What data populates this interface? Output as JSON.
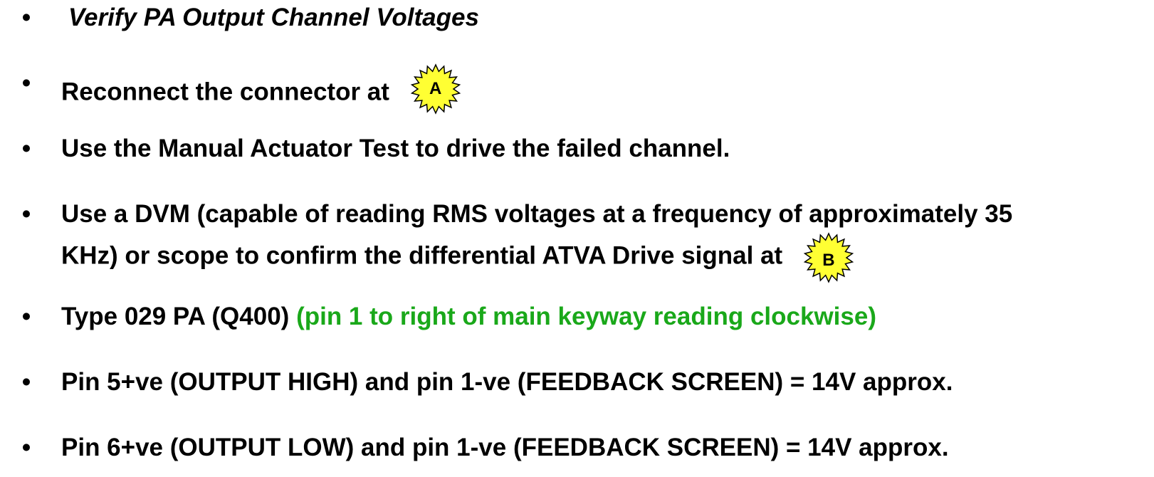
{
  "bullet_glyph": "•",
  "items": [
    {
      "text": "Verify PA Output Channel Voltages"
    },
    {
      "text": "Reconnect the connector at",
      "marker": "A"
    },
    {
      "text": "Use the Manual Actuator Test to drive the failed channel."
    },
    {
      "line1": "Use a DVM (capable of reading RMS voltages at a frequency of approximately 35",
      "line2": "KHz) or scope to confirm the differential ATVA Drive signal at",
      "marker": "B"
    },
    {
      "text": "Type 029 PA (Q400)",
      "note": "(pin 1 to right of main keyway reading clockwise)"
    },
    {
      "text": "Pin 5+ve (OUTPUT HIGH) and pin 1-ve (FEEDBACK SCREEN) = 14V approx."
    },
    {
      "text": "Pin 6+ve (OUTPUT LOW) and pin 1-ve (FEEDBACK SCREEN) = 14V approx."
    }
  ],
  "colors": {
    "text": "#000000",
    "note": "#1aa81a",
    "marker_fill": "#ffff33",
    "marker_stroke": "#000000"
  },
  "icons": {
    "bullet": "bullet-dot-icon",
    "marker": "starburst-icon"
  }
}
